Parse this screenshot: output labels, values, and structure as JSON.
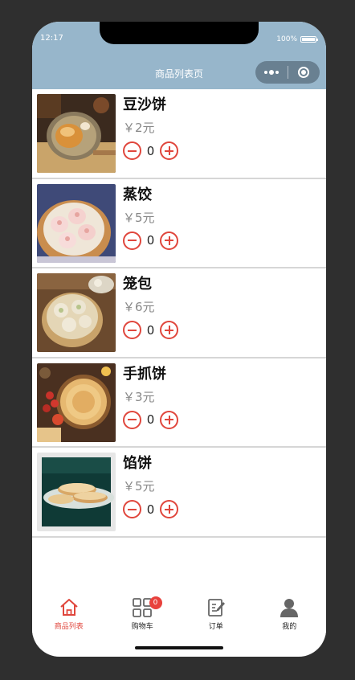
{
  "status": {
    "time": "12:17",
    "battery": "100%"
  },
  "navbar": {
    "title": "商品列表页"
  },
  "products": [
    {
      "name": "豆沙饼",
      "price": "￥2元",
      "qty": "0",
      "image": "bean-paste-pastry"
    },
    {
      "name": "蒸饺",
      "price": "￥5元",
      "qty": "0",
      "image": "steamed-dumplings"
    },
    {
      "name": "笼包",
      "price": "￥6元",
      "qty": "0",
      "image": "basket-buns"
    },
    {
      "name": "手抓饼",
      "price": "￥3元",
      "qty": "0",
      "image": "hand-pulled-pancake"
    },
    {
      "name": "馅饼",
      "price": "￥5元",
      "qty": "0",
      "image": "stuffed-pie"
    }
  ],
  "tabbar": {
    "items": [
      {
        "label": "商品列表",
        "icon": "home-icon",
        "active": true
      },
      {
        "label": "购物车",
        "icon": "grid-icon",
        "badge": "0"
      },
      {
        "label": "订单",
        "icon": "edit-doc-icon"
      },
      {
        "label": "我的",
        "icon": "user-icon"
      }
    ]
  },
  "colors": {
    "accent": "#e0463c",
    "navbar": "#97b6cb"
  }
}
